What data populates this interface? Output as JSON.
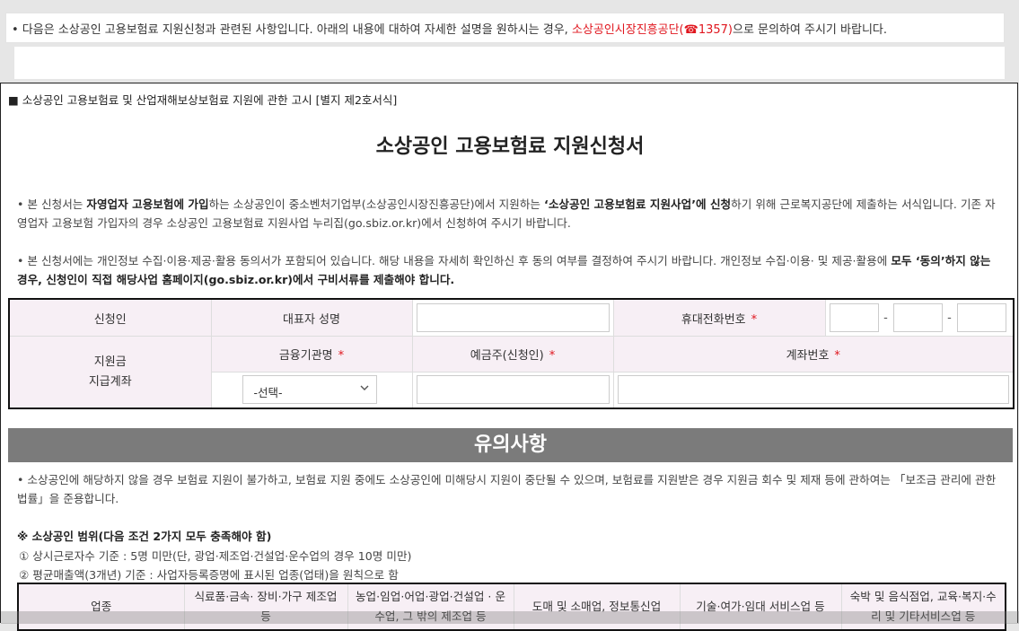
{
  "notice": {
    "text_before": "• 다음은 소상공인 고용보험료 지원신청과 관련된 사항입니다. 아래의 내용에 대하여 자세한 설명을 원하시는 경우, ",
    "agency": "소상공인시장진흥공단(☎1357)",
    "text_after": "으로 문의하여 주시기 바랍니다."
  },
  "form": {
    "reference": "■ 소상공인 고용보험료 및 산업재해보상보험료 지원에 관한 고시 [별지 제2호서식]",
    "title": "소상공인 고용보험료 지원신청서",
    "para1": {
      "t1": "• 본 신청서는 ",
      "b1": "자영업자 고용보험에 가입",
      "t2": "하는 소상공인이 중소벤처기업부(소상공인시장진흥공단)에서 지원하는 ",
      "b2": "‘소상공인 고용보험료 지원사업’에 신청",
      "t3": "하기 위해 근로복지공단에 제출하는 서식입니다. 기존 자영업자 고용보험 가입자의 경우 소상공인 고용보험료 지원사업 누리집(go.sbiz.or.kr)에서 신청하여 주시기 바랍니다."
    },
    "para2": {
      "t1": "• 본 신청서에는 개인정보 수집·이용·제공·활용 동의서가 포함되어 있습니다. 해당 내용을 자세히 확인하신 후 동의 여부를 결정하여 주시기 바랍니다. 개인정보 수집·이용· 및 제공·활용에 ",
      "b1": "모두 ‘동의’하지 않는 경우, 신청인이 직접 해당사업 홈페이지(go.sbiz.or.kr)에서 구비서류를 제출해야 합니다."
    },
    "applicant_label": "신청인",
    "rep_name_label": "대표자 성명",
    "rep_name_value": "",
    "phone_label": "휴대전화번호",
    "phone_parts": [
      "",
      "",
      ""
    ],
    "phone_sep": "-",
    "account_label_1": "지원금",
    "account_label_2": "지급계좌",
    "bank_label": "금융기관명",
    "bank_selected": "-선택-",
    "holder_label": "예금주(신청인)",
    "holder_value": "",
    "account_no_label": "계좌번호",
    "account_no_value": "",
    "required_mark": "*"
  },
  "notes": {
    "title": "유의사항",
    "para": "• 소상공인에 해당하지 않을 경우 보험료 지원이 불가하고, 보험료 지원 중에도 소상공인에 미해당시 지원이 중단될 수 있으며, 보험료를 지원받은 경우 지원금 회수 및 제재 등에 관하여는 「보조금 관리에 관한 법률」을 준용합니다.",
    "scope_title": "※ 소상공인 범위(다음 조건 2가지 모두 충족해야 함)",
    "scope_1": "① 상시근로자수 기준 : 5명 미만(단, 광업·제조업·건설업·운수업의 경우 10명 미만)",
    "scope_2": "② 평균매출액(3개년) 기준 : 사업자등록증명에 표시된 업종(업태)을 원칙으로 함",
    "industry_header": [
      "업종",
      "식료품·금속· 장비·가구 제조업 등",
      "농업·임업·어업·광업·건설업 · 운수업, 그 밖의 제조업 등",
      "도매 및 소매업, 정보통신업",
      "기술·여가·임대 서비스업 등",
      "숙박 및 음식점업, 교육·복지·수리 및 기타서비스업 등"
    ]
  },
  "colors": {
    "accent_red": "#e0161e",
    "header_bg": "#f7eff5",
    "section_bar": "#7b7b7b"
  },
  "icons": {
    "select_chevron": "chevron-down-icon"
  }
}
